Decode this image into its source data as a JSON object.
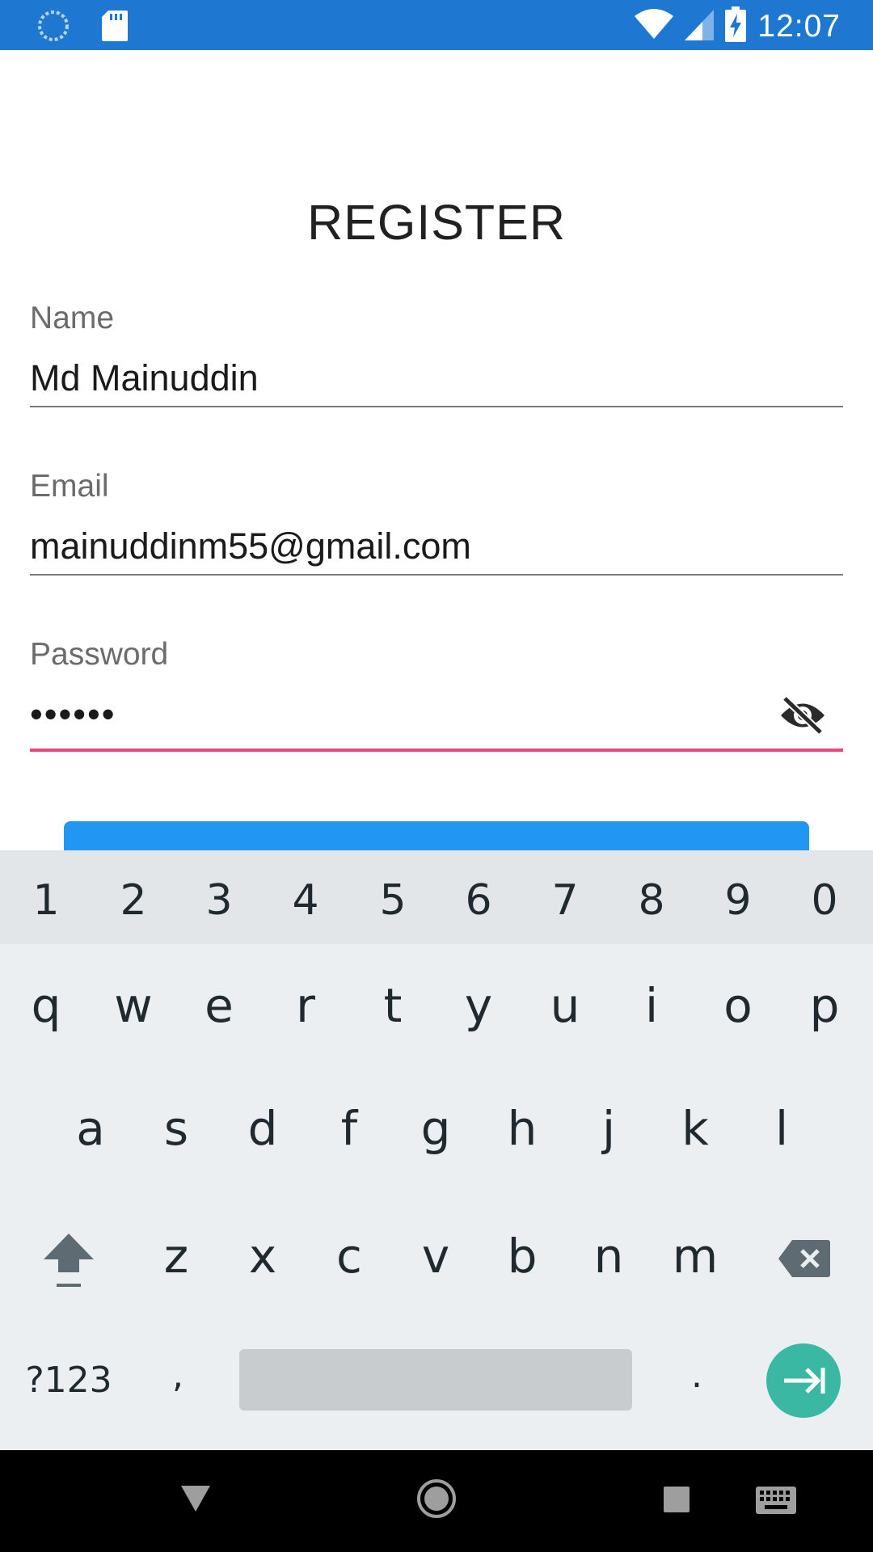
{
  "status_bar": {
    "time": "12:07",
    "icons": [
      "loading-icon",
      "sd-card-icon",
      "wifi-icon",
      "signal-icon",
      "battery-charging-icon"
    ]
  },
  "form": {
    "title": "REGISTER",
    "name_label": "Name",
    "name_value": "Md Mainuddin",
    "email_label": "Email",
    "email_value": "mainuddinm55@gmail.com",
    "password_label": "Password",
    "password_value": "••••••"
  },
  "keyboard": {
    "number_row": [
      "1",
      "2",
      "3",
      "4",
      "5",
      "6",
      "7",
      "8",
      "9",
      "0"
    ],
    "row1": [
      "q",
      "w",
      "e",
      "r",
      "t",
      "y",
      "u",
      "i",
      "o",
      "p"
    ],
    "row2": [
      "a",
      "s",
      "d",
      "f",
      "g",
      "h",
      "j",
      "k",
      "l"
    ],
    "row3": [
      "z",
      "x",
      "c",
      "v",
      "b",
      "n",
      "m"
    ],
    "symbols_key": "?123",
    "comma_key": ",",
    "period_key": "."
  },
  "colors": {
    "status_bar": "#1e78d2",
    "accent_focus": "#e8457f",
    "button": "#2196f3",
    "enter_key": "#3bb8a3"
  }
}
